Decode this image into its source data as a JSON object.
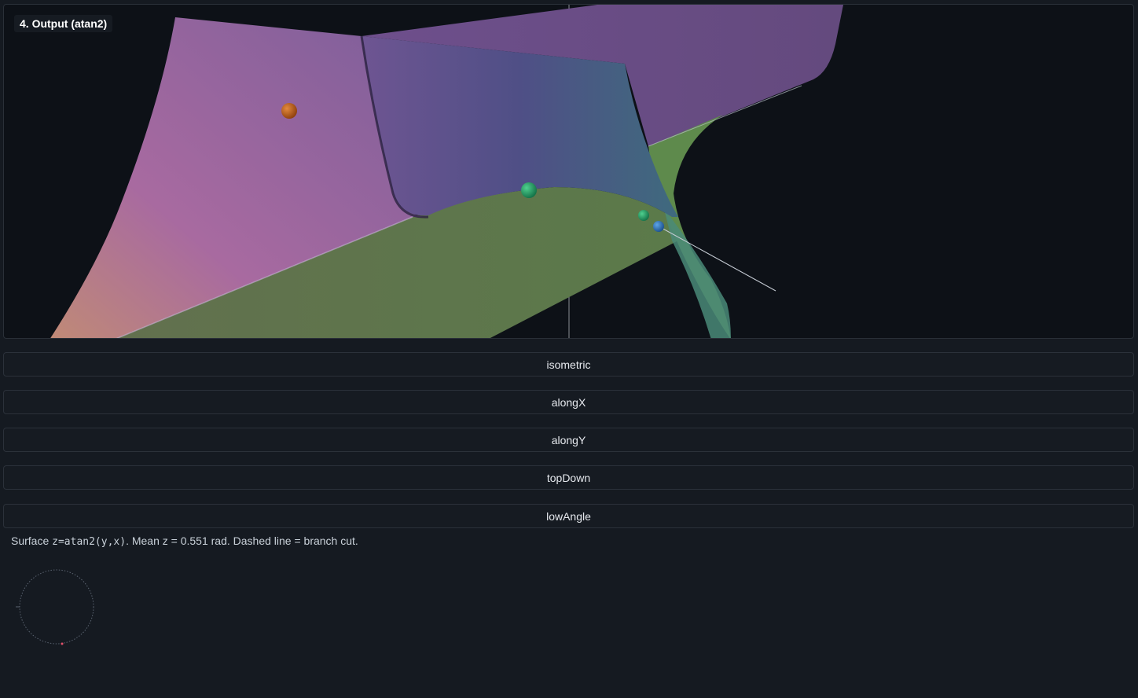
{
  "panel": {
    "title": "4. Output (atan2)"
  },
  "views": [
    "isometric",
    "alongX",
    "alongY",
    "topDown",
    "lowAngle"
  ],
  "caption": {
    "prefix": "Surface ",
    "formula": "z=atan2(y,x)",
    "suffix": ". Mean z = 0.551 rad. Dashed line = branch cut."
  },
  "colors": {
    "background": "#151a21",
    "viewport_bg": "#0d1117",
    "marker_orange": "#c8641c",
    "marker_green": "#1fa86a",
    "marker_blue": "#2a78c8"
  }
}
